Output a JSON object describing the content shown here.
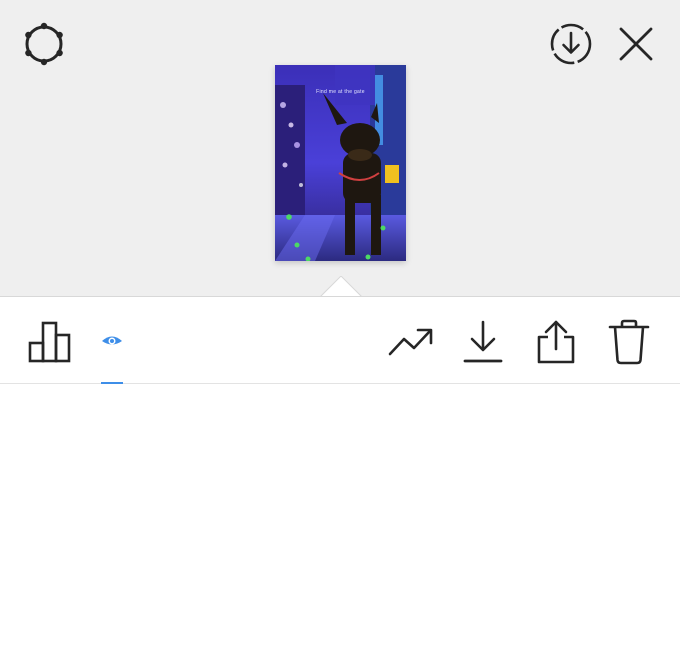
{
  "header": {
    "settings_icon": "settings-gear-icon",
    "save_icon": "download-circle-icon",
    "close_icon": "close-icon"
  },
  "story_preview": {
    "caption": "Find me at the gate"
  },
  "toolbar": {
    "items": [
      {
        "name": "insights-icon"
      },
      {
        "name": "viewers-eye-icon",
        "active": true
      },
      {
        "name": "promote-icon"
      },
      {
        "name": "download-icon"
      },
      {
        "name": "share-icon"
      },
      {
        "name": "delete-icon"
      }
    ]
  },
  "colors": {
    "active_tab": "#3e8ee8",
    "icon": "#262626",
    "top_background": "#efefef"
  }
}
